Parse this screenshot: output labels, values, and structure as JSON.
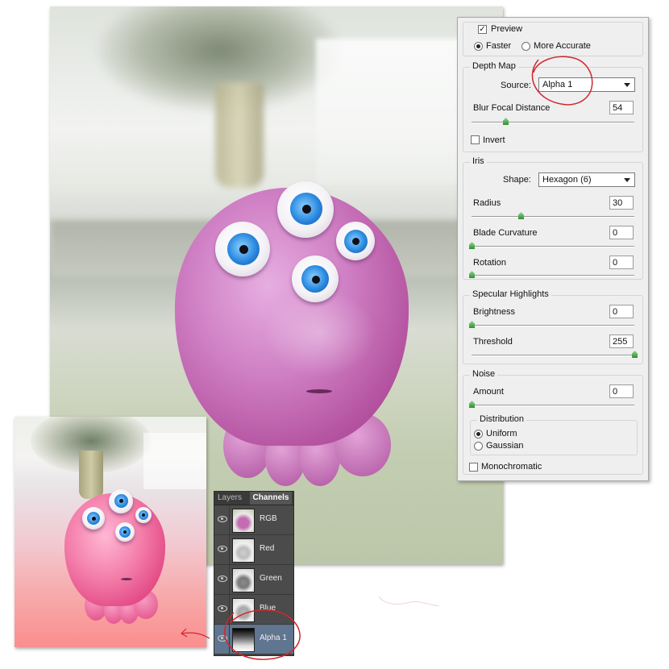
{
  "dialog": {
    "preview_label": "Preview",
    "preview_checked": true,
    "quality_faster": "Faster",
    "quality_accurate": "More Accurate",
    "quality_selected": "Faster",
    "depth_map": {
      "title": "Depth Map",
      "source_label": "Source:",
      "source_value": "Alpha 1",
      "blur_label": "Blur Focal Distance",
      "blur_value": "54",
      "blur_level": 0.21,
      "invert_label": "Invert",
      "invert_checked": false
    },
    "iris": {
      "title": "Iris",
      "shape_label": "Shape:",
      "shape_value": "Hexagon (6)",
      "radius_label": "Radius",
      "radius_value": "30",
      "radius_level": 0.3,
      "curvature_label": "Blade Curvature",
      "curvature_value": "0",
      "rotation_label": "Rotation",
      "rotation_value": "0"
    },
    "specular": {
      "title": "Specular Highlights",
      "brightness_label": "Brightness",
      "brightness_value": "0",
      "threshold_label": "Threshold",
      "threshold_value": "255",
      "threshold_level": 1.0
    },
    "noise": {
      "title": "Noise",
      "amount_label": "Amount",
      "amount_value": "0",
      "distribution_title": "Distribution",
      "uniform_label": "Uniform",
      "gaussian_label": "Gaussian",
      "distribution_selected": "Uniform",
      "mono_label": "Monochromatic",
      "mono_checked": false
    }
  },
  "channels_panel": {
    "tab_layers": "Layers",
    "tab_channels": "Channels",
    "rows": [
      {
        "name": "RGB",
        "thumb": "color"
      },
      {
        "name": "Red",
        "thumb": "gray"
      },
      {
        "name": "Green",
        "thumb": "gray"
      },
      {
        "name": "Blue",
        "thumb": "gray"
      },
      {
        "name": "Alpha 1",
        "thumb": "gradient",
        "selected": true
      }
    ]
  },
  "colors": {
    "monster_pink": "#c56bb4",
    "annotation_red": "#d0272f",
    "selection_blue": "#5f7590"
  }
}
